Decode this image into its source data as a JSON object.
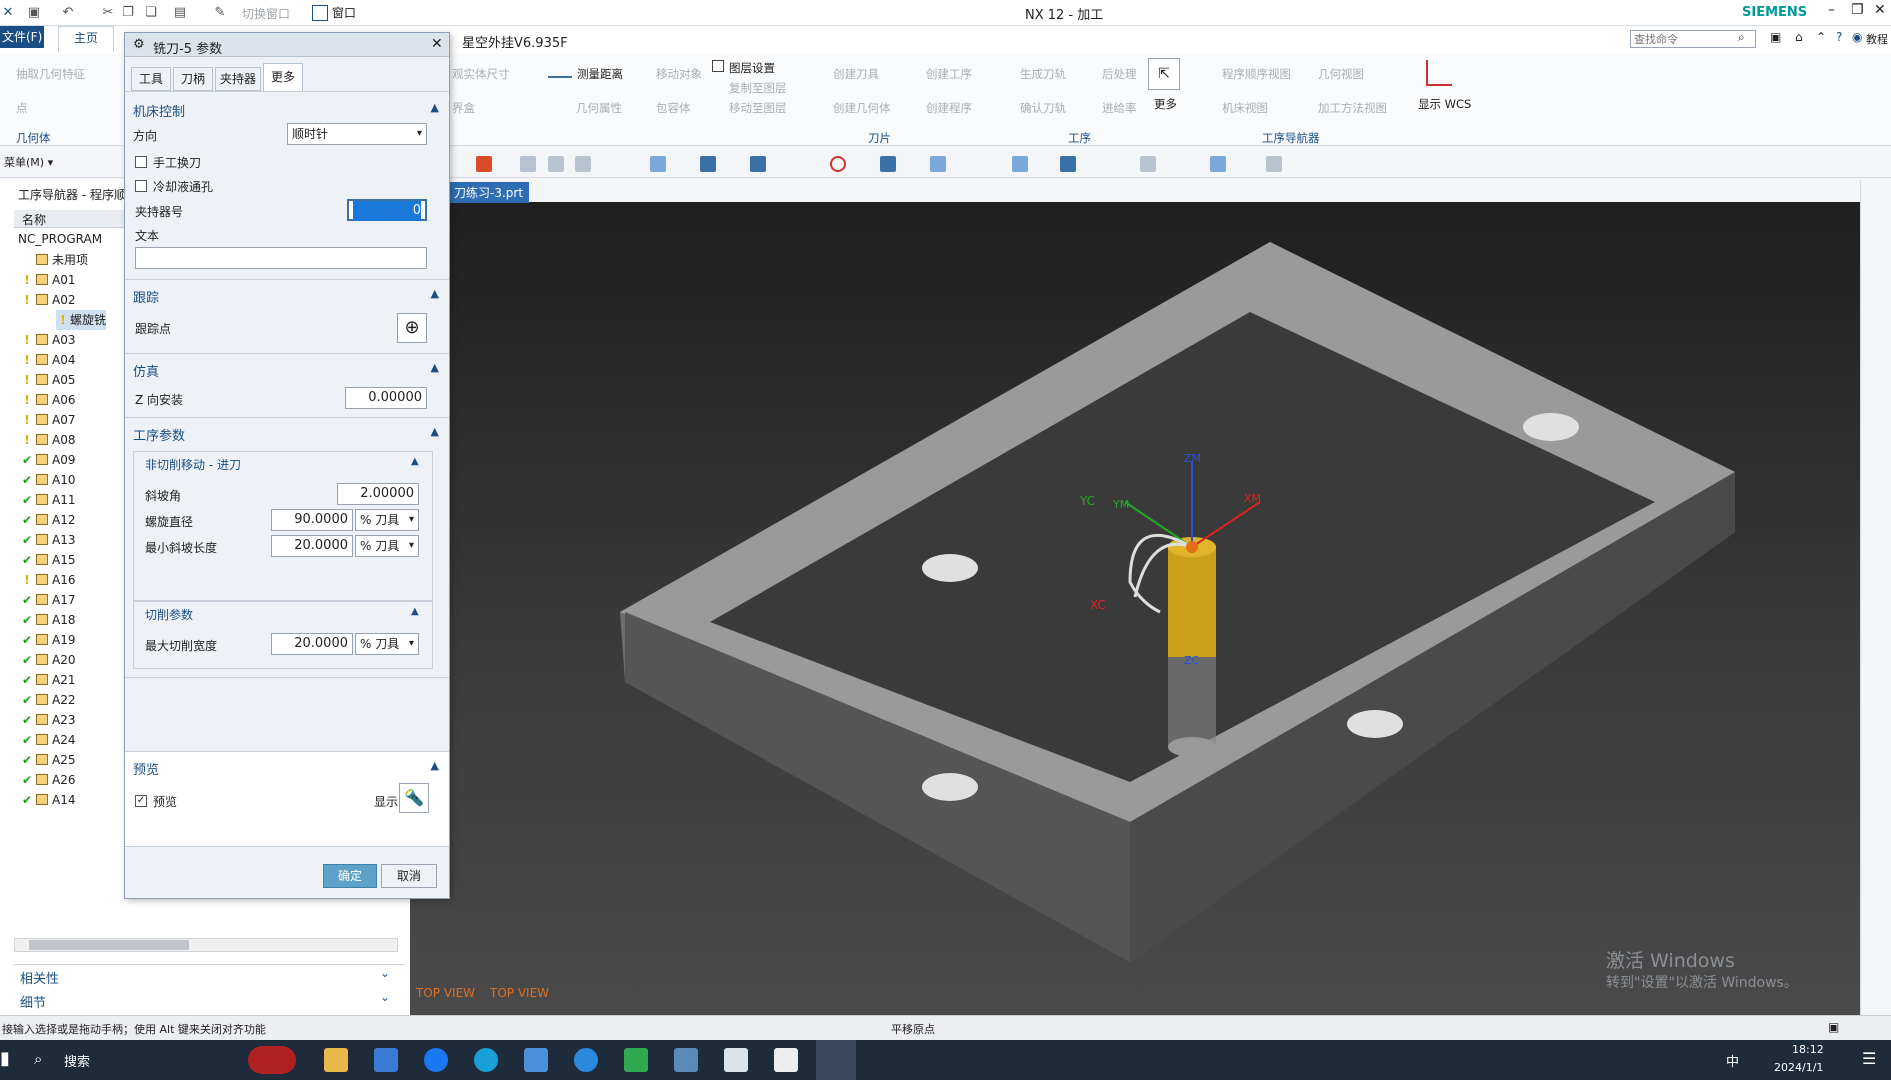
{
  "window": {
    "title": "NX 12 - 加工",
    "brand": "SIEMENS",
    "dropdown_window": "窗口",
    "switch_window": "切换窗口"
  },
  "menubar": {
    "file": "文件(F)",
    "tab_home": "主页",
    "plugin": "星空外挂V6.935F",
    "search_placeholder": "查找命令",
    "tutorial": "教程"
  },
  "ribbon": {
    "extract_feature": "抽取几何特征",
    "point": "点",
    "group_geometry": "几何体",
    "view_solid_size": "观实体尺寸",
    "measure_distance": "测量距离",
    "move_object": "移动对象",
    "layer_settings": "图层设置",
    "copy_to_layer": "复制至图层",
    "move_to_layer": "移动至图层",
    "boundary": "界盒",
    "geometry_attr": "几何属性",
    "bounding_body": "包容体",
    "create_tool": "创建刀具",
    "create_geometry": "创建几何体",
    "create_operation": "创建工序",
    "create_program": "创建程序",
    "group_tool": "刀片",
    "generate_path": "生成刀轨",
    "postprocess": "后处理",
    "verify_path": "确认刀轨",
    "shop_docs": "进给率",
    "group_operation": "工序",
    "more": "更多",
    "program_order_view": "程序顺序视图",
    "machine_view": "机床视图",
    "geometry_view": "几何视图",
    "method_view": "加工方法视图",
    "group_navigator": "工序导航器",
    "show_wcs": "显示 WCS"
  },
  "navigator": {
    "title": "工序导航器 - 程序顺",
    "col_name": "名称",
    "root": "NC_PROGRAM",
    "unused": "未用项",
    "selected_op": "螺旋铣",
    "items": [
      {
        "name": "A01",
        "state": "warn"
      },
      {
        "name": "A02",
        "state": "warn"
      },
      {
        "name": "A03",
        "state": "warn"
      },
      {
        "name": "A04",
        "state": "warn"
      },
      {
        "name": "A05",
        "state": "warn"
      },
      {
        "name": "A06",
        "state": "warn"
      },
      {
        "name": "A07",
        "state": "warn"
      },
      {
        "name": "A08",
        "state": "warn"
      },
      {
        "name": "A09",
        "state": "ok"
      },
      {
        "name": "A10",
        "state": "ok"
      },
      {
        "name": "A11",
        "state": "ok"
      },
      {
        "name": "A12",
        "state": "ok"
      },
      {
        "name": "A13",
        "state": "ok"
      },
      {
        "name": "A15",
        "state": "ok"
      },
      {
        "name": "A16",
        "state": "warn"
      },
      {
        "name": "A17",
        "state": "ok"
      },
      {
        "name": "A18",
        "state": "ok"
      },
      {
        "name": "A19",
        "state": "ok"
      },
      {
        "name": "A20",
        "state": "ok"
      },
      {
        "name": "A21",
        "state": "ok"
      },
      {
        "name": "A22",
        "state": "ok"
      },
      {
        "name": "A23",
        "state": "ok"
      },
      {
        "name": "A24",
        "state": "ok"
      },
      {
        "name": "A25",
        "state": "ok"
      },
      {
        "name": "A26",
        "state": "ok"
      },
      {
        "name": "A14",
        "state": "ok"
      }
    ],
    "dependencies": "相关性",
    "details": "细节"
  },
  "dialog": {
    "title": "铣刀-5 参数",
    "tabs": [
      "工具",
      "刀柄",
      "夹持器",
      "更多"
    ],
    "machine_control": "机床控制",
    "direction_label": "方向",
    "direction_value": "顺时针",
    "manual_tool_change": "手工换刀",
    "coolant_hole": "冷却液通孔",
    "holder_number_label": "夹持器号",
    "holder_number_value": "0",
    "text_label": "文本",
    "text_value": "",
    "tracking": "跟踪",
    "tracking_point": "跟踪点",
    "simulation": "仿真",
    "z_mount_label": "Z 向安装",
    "z_mount_value": "0.00000",
    "op_params": "工序参数",
    "noncut_group": "非切削移动 - 进刀",
    "ramp_angle_label": "斜坡角",
    "ramp_angle_value": "2.00000",
    "helix_diameter_label": "螺旋直径",
    "helix_diameter_value": "90.0000",
    "helix_unit": "% 刀具",
    "min_ramp_label": "最小斜坡长度",
    "min_ramp_value": "20.0000",
    "min_ramp_unit": "% 刀具",
    "cut_params": "切削参数",
    "max_cut_width_label": "最大切削宽度",
    "max_cut_width_value": "20.0000",
    "max_cut_width_unit": "% 刀具",
    "preview_section": "预览",
    "preview_checkbox": "预览",
    "display_label": "显示",
    "ok": "确定",
    "cancel": "取消"
  },
  "viewport": {
    "tab_name": "刀练习-3.prt",
    "view_label_1": "TOP VIEW",
    "view_label_2": "TOP VIEW",
    "axes": {
      "zm": "ZM",
      "xm": "XM",
      "yc": "YC",
      "ym": "YM",
      "xc": "XC",
      "zc": "ZC"
    },
    "watermark_1": "激活 Windows",
    "watermark_2": "转到\"设置\"以激活 Windows。"
  },
  "statusbar": {
    "left": "接输入选择或是拖动手柄；使用 Alt 键来关闭对齐功能",
    "center": "平移原点"
  },
  "taskbar": {
    "search": "搜索",
    "time": "18:12",
    "date": "2024/1/1",
    "ime": "中"
  },
  "colors": {
    "accent": "#1a4f86",
    "ok_button": "#5ea2c9",
    "ok_check": "#1aa01a",
    "warn": "#e0b000"
  }
}
